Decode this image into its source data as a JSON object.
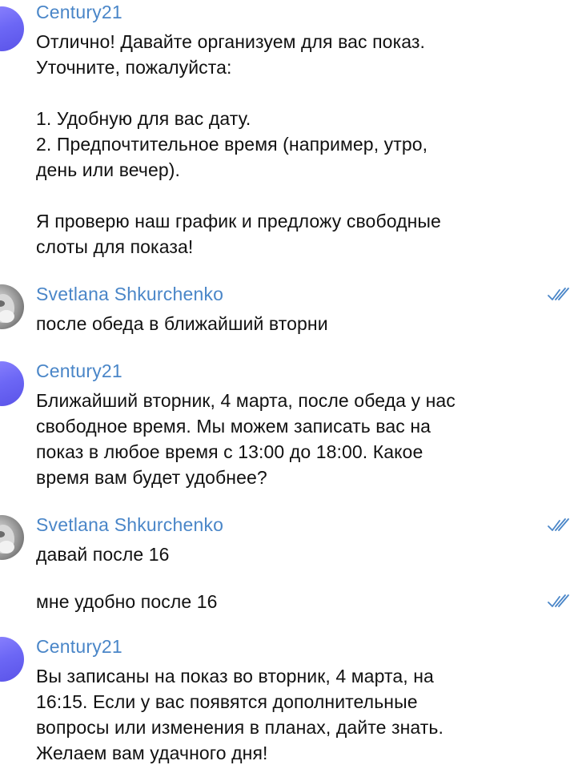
{
  "messages": [
    {
      "sender": "Century21",
      "text": "Отлично! Давайте организуем для вас показ.\nУточните, пожалуйста:\n\n1. Удобную для вас дату.\n2. Предпочтительное время (например, утро,\nдень или вечер).\n\nЯ проверю наш график и предложу свободные\nслоты для показа!"
    },
    {
      "sender": "Svetlana Shkurchenko",
      "text": "после обеда в ближайший вторни",
      "status": "read"
    },
    {
      "sender": "Century21",
      "text": "Ближайший вторник, 4 марта, после обеда у нас\nсвободное время. Мы можем записать вас на\nпоказ в любое время с 13:00 до 18:00. Какое\nвремя вам будет удобнее?"
    },
    {
      "sender": "Svetlana Shkurchenko",
      "text": "давай после 16",
      "status": "read"
    },
    {
      "text": "мне удобно после 16",
      "status": "read"
    },
    {
      "sender": "Century21",
      "text": "Вы записаны на показ во вторник, 4 марта, на\n16:15. Если у вас появятся дополнительные\nвопросы или изменения в планах, дайте знать.\nЖелаем вам удачного дня!"
    }
  ],
  "colors": {
    "sender_name": "#4a86c8",
    "text": "#111111",
    "read_check": "#4a86c8",
    "bot_avatar": "#6c67f5"
  },
  "icons": {
    "read_status": "double-check-icon"
  }
}
